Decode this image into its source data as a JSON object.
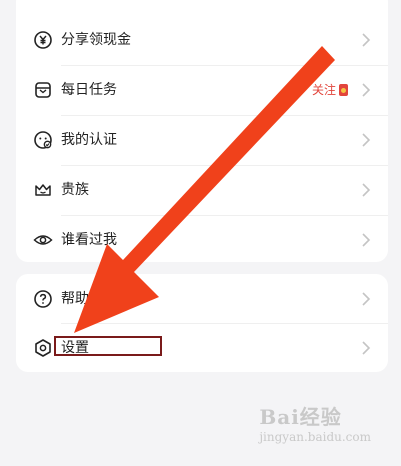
{
  "menu_group_1": [
    {
      "label": "分享领现金",
      "icon": "yuan-coin-icon"
    },
    {
      "label": "每日任务",
      "icon": "task-box-icon",
      "badge": "关注"
    },
    {
      "label": "我的认证",
      "icon": "verified-face-icon"
    },
    {
      "label": "贵族",
      "icon": "crown-icon"
    },
    {
      "label": "谁看过我",
      "icon": "eye-icon"
    }
  ],
  "menu_group_2": [
    {
      "label": "帮助与反馈",
      "icon": "question-circle-icon"
    },
    {
      "label": "设置",
      "icon": "settings-hexagon-icon"
    }
  ],
  "colors": {
    "background": "#f4f4f6",
    "card": "#ffffff",
    "badge": "#e2453c",
    "annotation_arrow": "#f0411b",
    "annotation_box": "#7a1a1a"
  },
  "watermark": {
    "brand": "Bai经验",
    "site": "jingyan.baidu.com"
  }
}
